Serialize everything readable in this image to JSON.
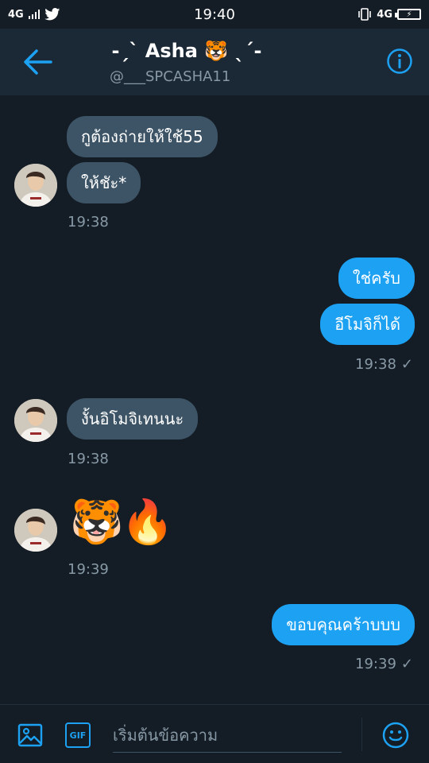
{
  "status_bar": {
    "network_left": "4G",
    "time": "19:40",
    "network_right": "4G",
    "battery_label": "⚡"
  },
  "header": {
    "title": "-ˏˋ Asha 🐯 ˎˊ-",
    "handle": "@___SPCASHA11"
  },
  "messages": {
    "m1": "กูต้องถ่ายให้ใช้55",
    "m2": "ให้ชัะ*",
    "t1": "19:38",
    "m3": "ใช่ครับ",
    "m4": "อีโมจิก็ได้",
    "t2": "19:38",
    "m5": "งั้นอิโมจิเทนนะ",
    "t3": "19:38",
    "m6_emoji_1": "🐯",
    "m6_emoji_2": "🔥",
    "t4": "19:39",
    "m7": "ขอบคุณคร้าบบบ",
    "t5": "19:39",
    "check": "✓"
  },
  "composer": {
    "placeholder": "เริ่มต้นข้อความ",
    "gif_label": "GIF"
  },
  "colors": {
    "background": "#141d26",
    "header": "#1b2836",
    "incoming_bubble": "#3d5466",
    "outgoing_bubble": "#1da1f2",
    "muted": "#8899a6"
  }
}
